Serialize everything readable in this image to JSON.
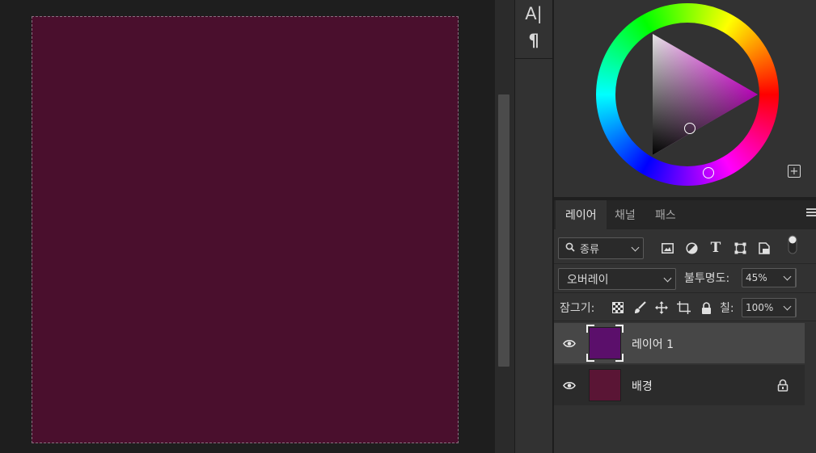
{
  "canvas": {
    "document_fill": "#4a0f2d",
    "layer1_fill": "#5b0f6b",
    "background_fill": "#5a1535"
  },
  "dock": {
    "char_icon_glyph": "A|",
    "paragraph_icon_glyph": "¶"
  },
  "color_panel": {
    "selected_hue": "#ff00ff",
    "expand_glyph": "+"
  },
  "layers_panel": {
    "tabs": [
      {
        "label": "레이어",
        "active": true
      },
      {
        "label": "채널",
        "active": false
      },
      {
        "label": "패스",
        "active": false
      }
    ],
    "filter": {
      "kind_label": "종류",
      "icons": [
        "image-filter-icon",
        "adjustment-filter-icon",
        "type-filter-icon",
        "shape-filter-icon",
        "smart-object-filter-icon",
        "filter-toggle-icon"
      ]
    },
    "blend_mode": "오버레이",
    "opacity_label": "불투명도:",
    "opacity_value": "45%",
    "lock_label": "잠그기:",
    "lock_icons": [
      "lock-transparent-icon",
      "lock-image-icon",
      "lock-position-icon",
      "lock-artboard-icon",
      "lock-all-icon"
    ],
    "fill_label": "칠:",
    "fill_value": "100%",
    "layers": [
      {
        "name": "레이어 1",
        "visible": true,
        "selected": true,
        "thumb_color": "#5b0f6b",
        "locked": false
      },
      {
        "name": "배경",
        "visible": true,
        "selected": false,
        "thumb_color": "#5a1535",
        "locked": true
      }
    ]
  }
}
